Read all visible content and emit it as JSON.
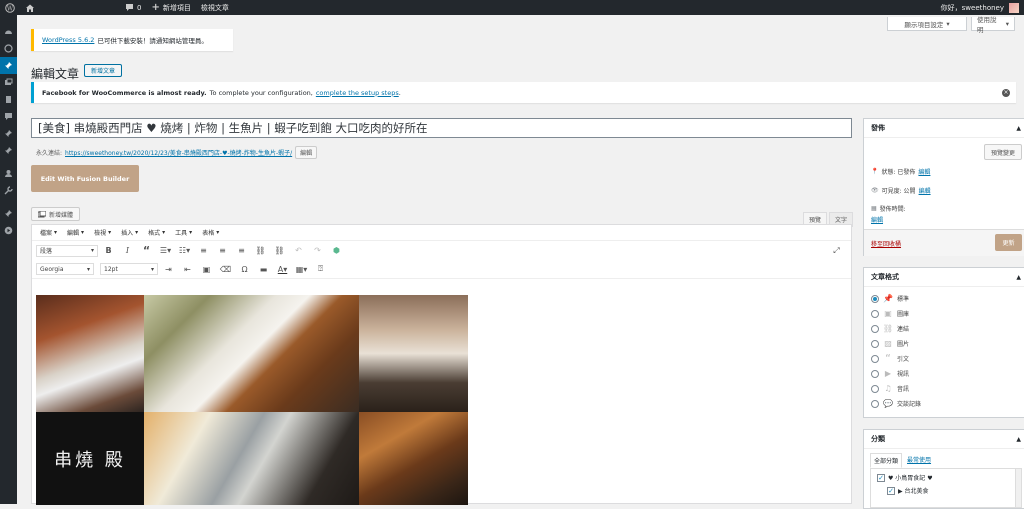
{
  "admin_bar": {
    "comments_count": "0",
    "new_item": "新增項目",
    "view_post": "檢視文章",
    "greeting": "你好，sweethoney"
  },
  "screen_options": "顯示項目設定",
  "help": "使用說明",
  "update_notice": {
    "link": "WordPress 5.6.2",
    "text": "已可供下載安裝！請通知網站管理員。"
  },
  "page": {
    "title": "編輯文章",
    "add_new": "新增文章"
  },
  "fb_notice": {
    "bold": "Facebook for WooCommerce is almost ready.",
    "text": "To complete your configuration,",
    "link": "complete the setup steps",
    "end": "."
  },
  "post": {
    "title": "[美食] 串燒殿西門店 ♥ 燒烤 | 炸物 | 生魚片 | 蝦子吃到飽 大口吃肉的好所在",
    "permalink_label": "永久連結:",
    "permalink_url": "https://sweethoney.tw/2020/12/23/美食-串燒殿西門店-♥-燒烤-炸物-生魚片-蝦子/",
    "permalink_edit": "編輯"
  },
  "fusion_button": "Edit With Fusion Builder",
  "add_media": "新增媒體",
  "editor_tabs": {
    "visual": "預覽",
    "text": "文字"
  },
  "menubar": [
    "檔案",
    "編輯",
    "檢視",
    "插入",
    "格式",
    "工具",
    "表格"
  ],
  "toolbar": {
    "block_format": "段落",
    "font_family": "Georgia",
    "font_size": "12pt"
  },
  "publish": {
    "title": "發佈",
    "preview": "預覽變更",
    "status_label": "狀態: 已發佈",
    "status_edit": "編輯",
    "visibility_label": "可見度: 公開",
    "visibility_edit": "編輯",
    "time_label": "發佈時間:",
    "time_edit": "編輯",
    "trash": "移至回收桶",
    "update": "更新"
  },
  "formats": {
    "title": "文章格式",
    "items": [
      "標準",
      "圖庫",
      "連結",
      "圖片",
      "引文",
      "視訊",
      "音訊",
      "交談記錄"
    ],
    "selected": "標準"
  },
  "categories": {
    "title": "分類",
    "tab_all": "全部分類",
    "tab_popular": "最常使用",
    "items": [
      "♥ 小鳥胃食記 ♥",
      "▶ 台北美食"
    ]
  },
  "image_text": "串燒 殿",
  "colors": {
    "admin_bar": "#23282d",
    "accent": "#0073aa",
    "fusion": "#c1a387",
    "update_button": "#c1a387"
  }
}
